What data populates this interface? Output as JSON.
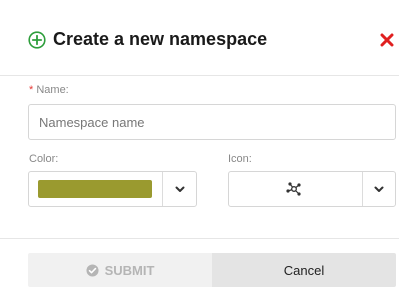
{
  "dialog": {
    "title": "Create a new namespace",
    "title_icon": "plus-circle-icon",
    "close_icon": "close-icon",
    "colors": {
      "accent": "#2e9e3c",
      "close": "#e02020"
    }
  },
  "form": {
    "name": {
      "required_marker": "*",
      "label": "Name:",
      "value": "",
      "placeholder": "Namespace name"
    },
    "color": {
      "label": "Color:",
      "selected_color": "#9a9a2f",
      "dropdown_icon": "chevron-down-icon"
    },
    "icon": {
      "label": "Icon:",
      "selected_icon": "namespace-network-icon",
      "dropdown_icon": "chevron-down-icon"
    }
  },
  "footer": {
    "submit_label": "SUBMIT",
    "submit_icon": "check-circle-icon",
    "submit_disabled": true,
    "cancel_label": "Cancel"
  }
}
